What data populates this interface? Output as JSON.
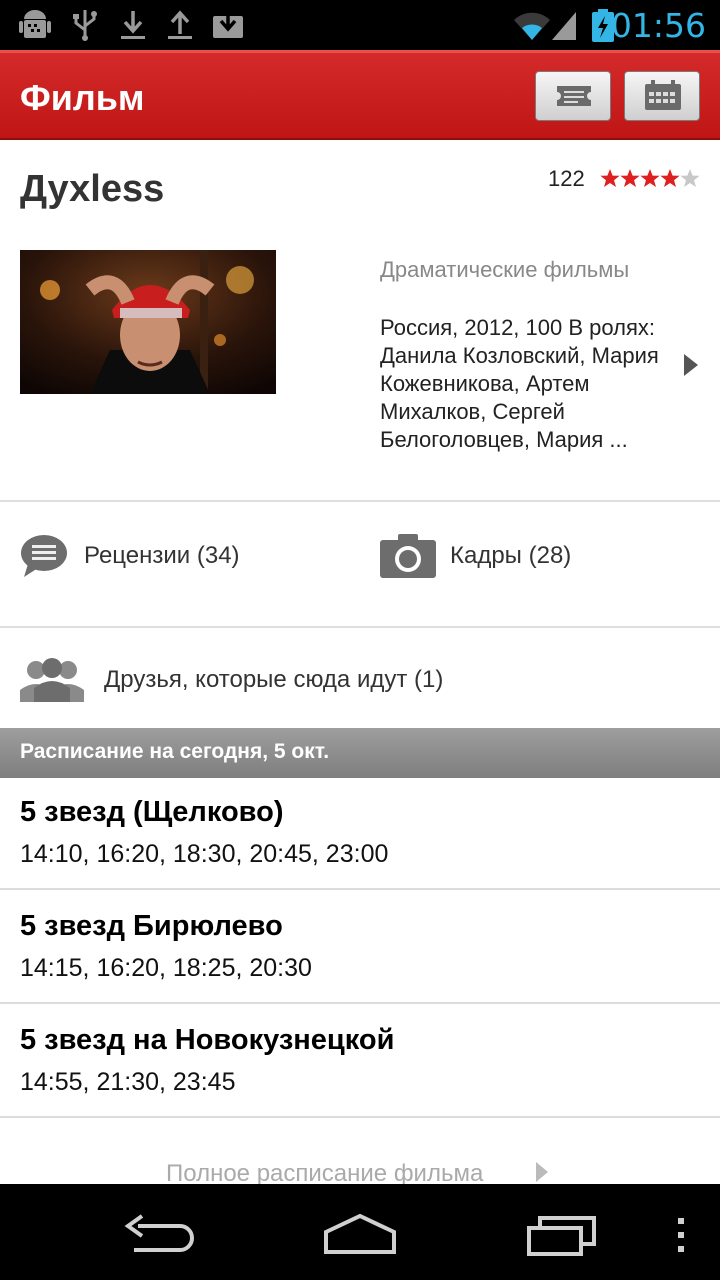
{
  "status_bar": {
    "time": "01:56",
    "time_color": "#33b5e5",
    "icons": [
      "android-debug-icon",
      "usb-icon",
      "download-icon",
      "upload-icon",
      "download-box-icon",
      "wifi-icon",
      "signal-icon",
      "battery-charging-icon"
    ]
  },
  "appbar": {
    "title": "Фильм",
    "background": "#c41818",
    "buttons": [
      "ticket-icon",
      "calendar-icon"
    ]
  },
  "film": {
    "title": "Духless",
    "rating_count": "122",
    "rating": 4,
    "rating_max": 5,
    "genre": "Драматические фильмы",
    "details": "Россия, 2012, 100 В ролях: Данила Козловский, Мария Кожевникова, Артем Михалков, Сергей Белоголовцев, Мария ..."
  },
  "links": {
    "reviews": "Рецензии (34)",
    "stills": "Кадры (28)",
    "friends": "Друзья, которые сюда идут (1)"
  },
  "schedule": {
    "header": "Расписание на сегодня, 5 окт.",
    "cinemas": [
      {
        "name": "5 звезд (Щелково)",
        "times": "14:10, 16:20, 18:30, 20:45, 23:00"
      },
      {
        "name": "5 звезд Бирюлево",
        "times": "14:15, 16:20, 18:25, 20:30"
      },
      {
        "name": "5 звезд на Новокузнецкой",
        "times": "14:55, 21:30, 23:45"
      }
    ],
    "full_link": "Полное расписание фильма"
  },
  "navbar": {
    "icons": [
      "back-icon",
      "home-icon",
      "recents-icon",
      "overflow-menu-icon"
    ]
  }
}
